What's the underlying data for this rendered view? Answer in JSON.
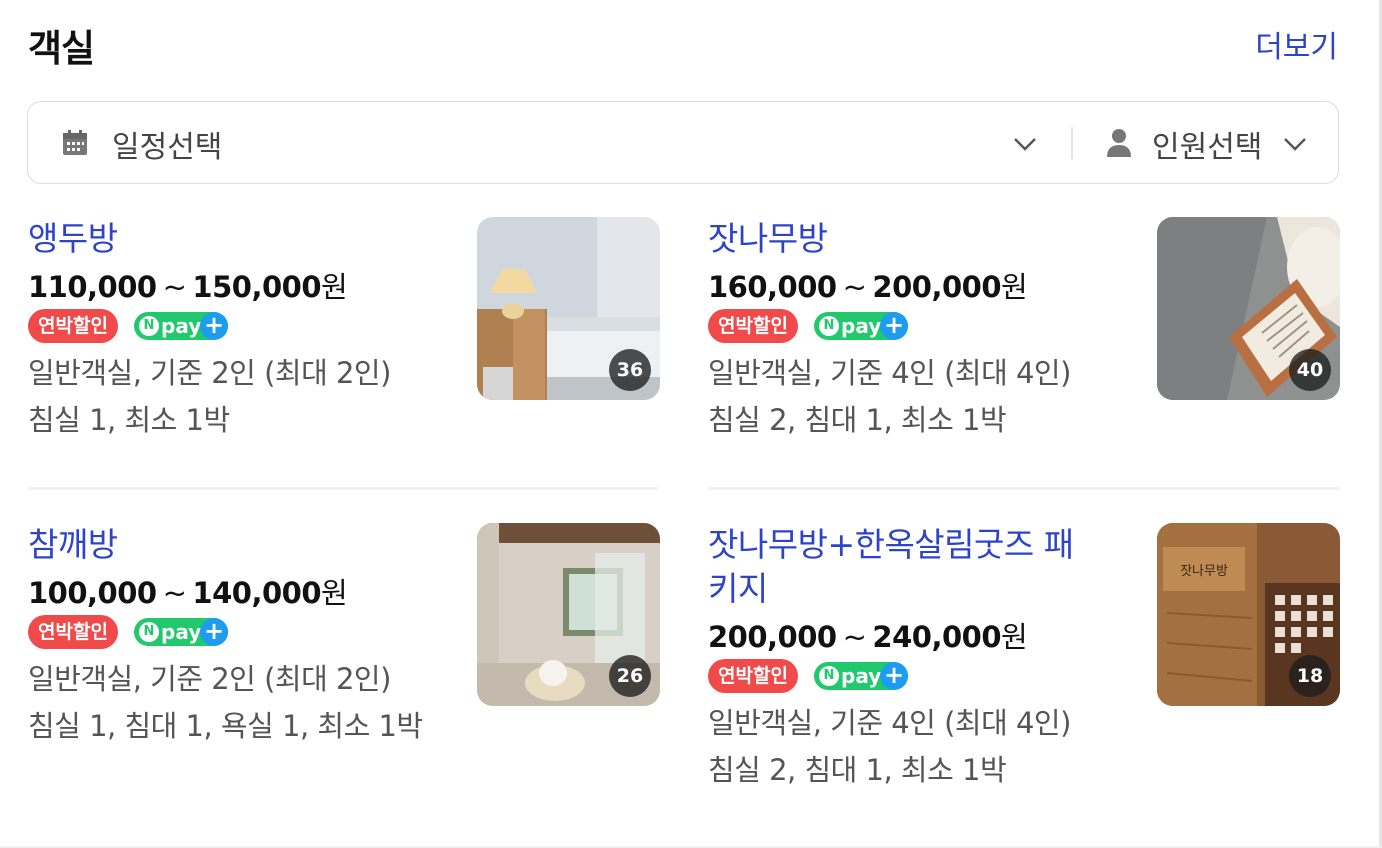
{
  "section": {
    "title": "객실",
    "more_label": "더보기"
  },
  "filters": {
    "date_label": "일정선택",
    "person_label": "인원선택"
  },
  "rooms": [
    {
      "name": "앵두방",
      "price_from": "110,000",
      "price_sep": "~",
      "price_to": "150,000",
      "currency": "원",
      "badge_discount": "연박할인",
      "badge_npay": "pay",
      "info": "일반객실, 기준 2인 (최대 2인)",
      "rule": "침실 1, 최소 1박",
      "photo_count": "36"
    },
    {
      "name": "잣나무방",
      "price_from": "160,000",
      "price_sep": "~",
      "price_to": "200,000",
      "currency": "원",
      "badge_discount": "연박할인",
      "badge_npay": "pay",
      "info": "일반객실, 기준 4인 (최대 4인)",
      "rule": "침실 2, 침대 1, 최소 1박",
      "photo_count": "40"
    },
    {
      "name": "참깨방",
      "price_from": "100,000",
      "price_sep": "~",
      "price_to": "140,000",
      "currency": "원",
      "badge_discount": "연박할인",
      "badge_npay": "pay",
      "info": "일반객실, 기준 2인 (최대 2인)",
      "rule": "침실 1, 침대 1, 욕실 1, 최소 1박",
      "photo_count": "26"
    },
    {
      "name": "잣나무방+한옥살림굿즈 패키지",
      "price_from": "200,000",
      "price_sep": "~",
      "price_to": "240,000",
      "currency": "원",
      "badge_discount": "연박할인",
      "badge_npay": "pay",
      "info": "일반객실, 기준 4인 (최대 4인)",
      "rule": "침실 2, 침대 1, 최소 1박",
      "photo_count": "18",
      "photo_sign_text": "잣나무방"
    }
  ],
  "colors": {
    "link_blue": "#2e44c8",
    "discount_red": "#f04a4a",
    "npay_green": "#20c96b",
    "npay_plus_blue": "#1e9cf0"
  },
  "icons": [
    "calendar-icon",
    "chevron-down-icon",
    "person-icon",
    "npay-logo"
  ]
}
